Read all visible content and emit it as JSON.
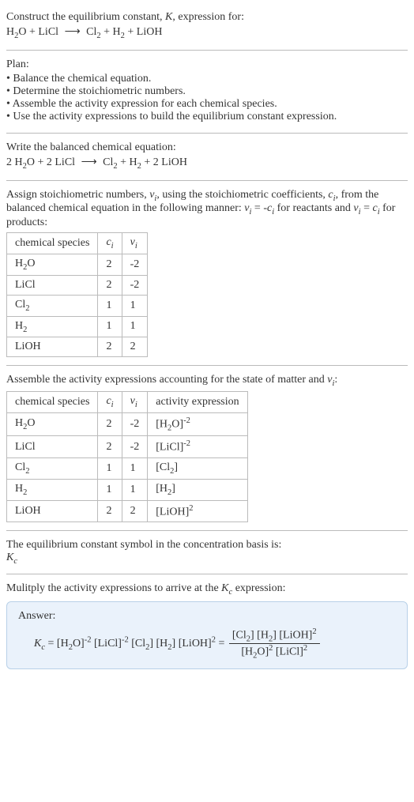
{
  "intro": {
    "line1": "Construct the equilibrium constant, K, expression for:",
    "equation": "H₂O + LiCl ⟶ Cl₂ + H₂ + LiOH"
  },
  "plan": {
    "title": "Plan:",
    "items": [
      "Balance the chemical equation.",
      "Determine the stoichiometric numbers.",
      "Assemble the activity expression for each chemical species.",
      "Use the activity expressions to build the equilibrium constant expression."
    ]
  },
  "balanced": {
    "title": "Write the balanced chemical equation:",
    "equation": "2 H₂O + 2 LiCl ⟶ Cl₂ + H₂ + 2 LiOH"
  },
  "stoich": {
    "intro_a": "Assign stoichiometric numbers, νᵢ, using the stoichiometric coefficients, cᵢ, from the balanced chemical equation in the following manner: νᵢ = -cᵢ for reactants and νᵢ = cᵢ for products:",
    "headers": [
      "chemical species",
      "cᵢ",
      "νᵢ"
    ],
    "rows": [
      {
        "species": "H₂O",
        "c": "2",
        "nu": "-2"
      },
      {
        "species": "LiCl",
        "c": "2",
        "nu": "-2"
      },
      {
        "species": "Cl₂",
        "c": "1",
        "nu": "1"
      },
      {
        "species": "H₂",
        "c": "1",
        "nu": "1"
      },
      {
        "species": "LiOH",
        "c": "2",
        "nu": "2"
      }
    ]
  },
  "activity": {
    "intro": "Assemble the activity expressions accounting for the state of matter and νᵢ:",
    "headers": [
      "chemical species",
      "cᵢ",
      "νᵢ",
      "activity expression"
    ],
    "rows": [
      {
        "species": "H₂O",
        "c": "2",
        "nu": "-2",
        "expr": "[H₂O]⁻²"
      },
      {
        "species": "LiCl",
        "c": "2",
        "nu": "-2",
        "expr": "[LiCl]⁻²"
      },
      {
        "species": "Cl₂",
        "c": "1",
        "nu": "1",
        "expr": "[Cl₂]"
      },
      {
        "species": "H₂",
        "c": "1",
        "nu": "1",
        "expr": "[H₂]"
      },
      {
        "species": "LiOH",
        "c": "2",
        "nu": "2",
        "expr": "[LiOH]²"
      }
    ]
  },
  "kc_symbol": {
    "line1": "The equilibrium constant symbol in the concentration basis is:",
    "line2": "K_c"
  },
  "multiply": {
    "intro": "Mulitply the activity expressions to arrive at the K_c expression:"
  },
  "answer": {
    "label": "Answer:",
    "lhs": "K_c = [H₂O]⁻² [LiCl]⁻² [Cl₂] [H₂] [LiOH]² = ",
    "num": "[Cl₂] [H₂] [LiOH]²",
    "den": "[H₂O]² [LiCl]²"
  }
}
